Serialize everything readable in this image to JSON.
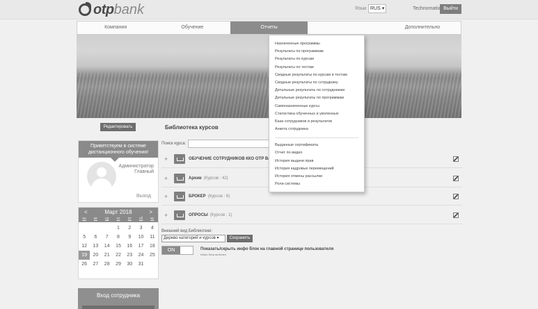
{
  "header": {
    "logo_otp": "otp",
    "logo_bank": "bank",
    "lang_label": "Язык",
    "lang_value": "RUS ▾",
    "user": "Technomatix",
    "logout": "Выйти"
  },
  "nav": {
    "tabs": [
      {
        "label": "Компания"
      },
      {
        "label": "Обучение"
      },
      {
        "label": "Отчеты",
        "active": true
      },
      {
        "label": ""
      },
      {
        "label": "Дополнительно"
      }
    ]
  },
  "reports_menu": {
    "items": [
      "Назначенные программы",
      "Результаты по программам",
      "Результаты по курсам",
      "Результаты по тестам",
      "Сводные результаты по курсам и тестам",
      "Сводные результаты по сотруднику",
      "Детальные результаты по сотрудникам",
      "Детальные результаты по программам",
      "Самоназначенные курсы",
      "Статистика обученных и уволенных",
      "База сотрудников и результатов",
      "Анкета сотрудника"
    ],
    "items2": [
      "Выданные сертификаты",
      "Отчет по видео",
      "История выдачи прав",
      "История кадровых перемещений",
      "История отмены рассылки",
      "Роли системы"
    ]
  },
  "sidebar": {
    "edit_button": "Редактировать",
    "welcome_title": "Приветствуем в системе дистанционного обучения!",
    "role_line1": "Администратор",
    "role_line2": "Главный",
    "exit": "Выход",
    "calendar": {
      "prev": "<",
      "title": "Март 2018",
      "next": ">",
      "dow": [
        "пн",
        "вт",
        "ср",
        "чт",
        "пт",
        "сб",
        "вс"
      ],
      "days": [
        "",
        "",
        "",
        "1",
        "2",
        "3",
        "4",
        "5",
        "6",
        "7",
        "8",
        "9",
        "10",
        "11",
        "12",
        "13",
        "14",
        "15",
        "16",
        "17",
        "18",
        "19",
        "20",
        "21",
        "22",
        "23",
        "24",
        "25",
        "26",
        "27",
        "28",
        "29",
        "30",
        "31",
        ""
      ],
      "today": "19"
    },
    "staff_login": "Вход сотрудника"
  },
  "library": {
    "title": "Библиотека курсов",
    "search_label": "Поиск курса:",
    "courses": [
      {
        "name": "ОБУЧЕНИЕ СОТРУДНИКОВ ККО ОТР Ва",
        "count": ""
      },
      {
        "name": "Архив",
        "count": "(Курсов : 42)"
      },
      {
        "name": "БРОКЕР",
        "count": "(Курсов : 6)"
      },
      {
        "name": "ОПРОСЫ",
        "count": "(Курсов : 1)"
      }
    ],
    "view_label": "Внешний вид Библиотеки:",
    "view_value": "Дерево категорий и курсов ▾",
    "save": "Сохранить",
    "toggle_on": "ON",
    "toggle_caption": "Показать/скрыть инфо блок на главной странице пользователя",
    "toggle_note": "Инфо блок включен"
  }
}
